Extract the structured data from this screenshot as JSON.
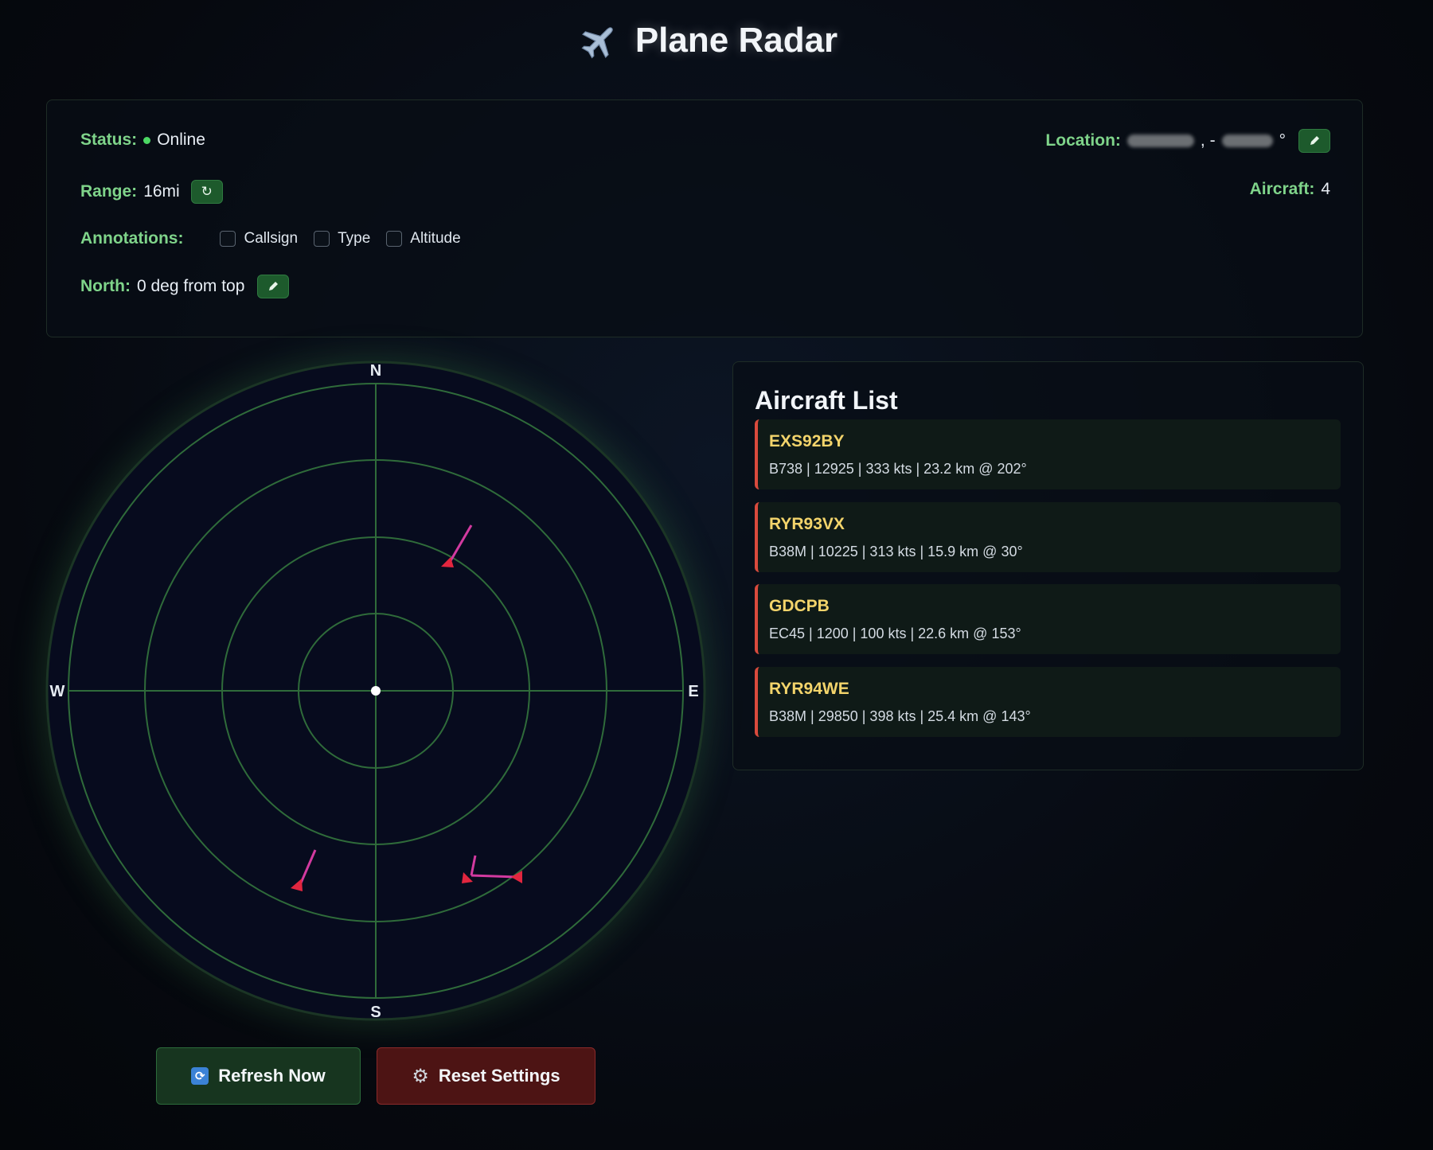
{
  "header": {
    "title": "Plane Radar",
    "icon": "airplane-icon"
  },
  "status_panel": {
    "status_label": "Status:",
    "status_value": "Online",
    "status_color": "#4cd964",
    "location_label": "Location:",
    "location_separator": ", -",
    "location_suffix": "°",
    "range_label": "Range:",
    "range_value": "16mi",
    "aircraft_label": "Aircraft:",
    "aircraft_count": "4",
    "annotations_label": "Annotations:",
    "annotations": [
      {
        "label": "Callsign",
        "checked": false
      },
      {
        "label": "Type",
        "checked": false
      },
      {
        "label": "Altitude",
        "checked": false
      }
    ],
    "north_label": "North:",
    "north_value": "0 deg from top",
    "edit_icon": "pencil-icon",
    "cycle_icon": "refresh-cycle-icon"
  },
  "radar": {
    "compass": {
      "n": "N",
      "s": "S",
      "e": "E",
      "w": "W"
    },
    "ring_color": "#2f6b3a",
    "plane_color": "#e2263f",
    "trail_color": "#d23aa0",
    "background": "#070b1e"
  },
  "aircraft_list": {
    "title": "Aircraft List",
    "items": [
      {
        "callsign": "EXS92BY",
        "details": "B738 | 12925 | 333 kts | 23.2 km @ 202°"
      },
      {
        "callsign": "RYR93VX",
        "details": "B38M | 10225 | 313 kts | 15.9 km @ 30°"
      },
      {
        "callsign": "GDCPB",
        "details": "EC45 | 1200 | 100 kts | 22.6 km @ 153°"
      },
      {
        "callsign": "RYR94WE",
        "details": "B38M | 29850 | 398 kts | 25.4 km @ 143°"
      }
    ]
  },
  "buttons": {
    "refresh_label": "Refresh Now",
    "refresh_icon": "refresh-icon",
    "reset_label": "Reset Settings",
    "reset_icon": "gear-icon"
  }
}
